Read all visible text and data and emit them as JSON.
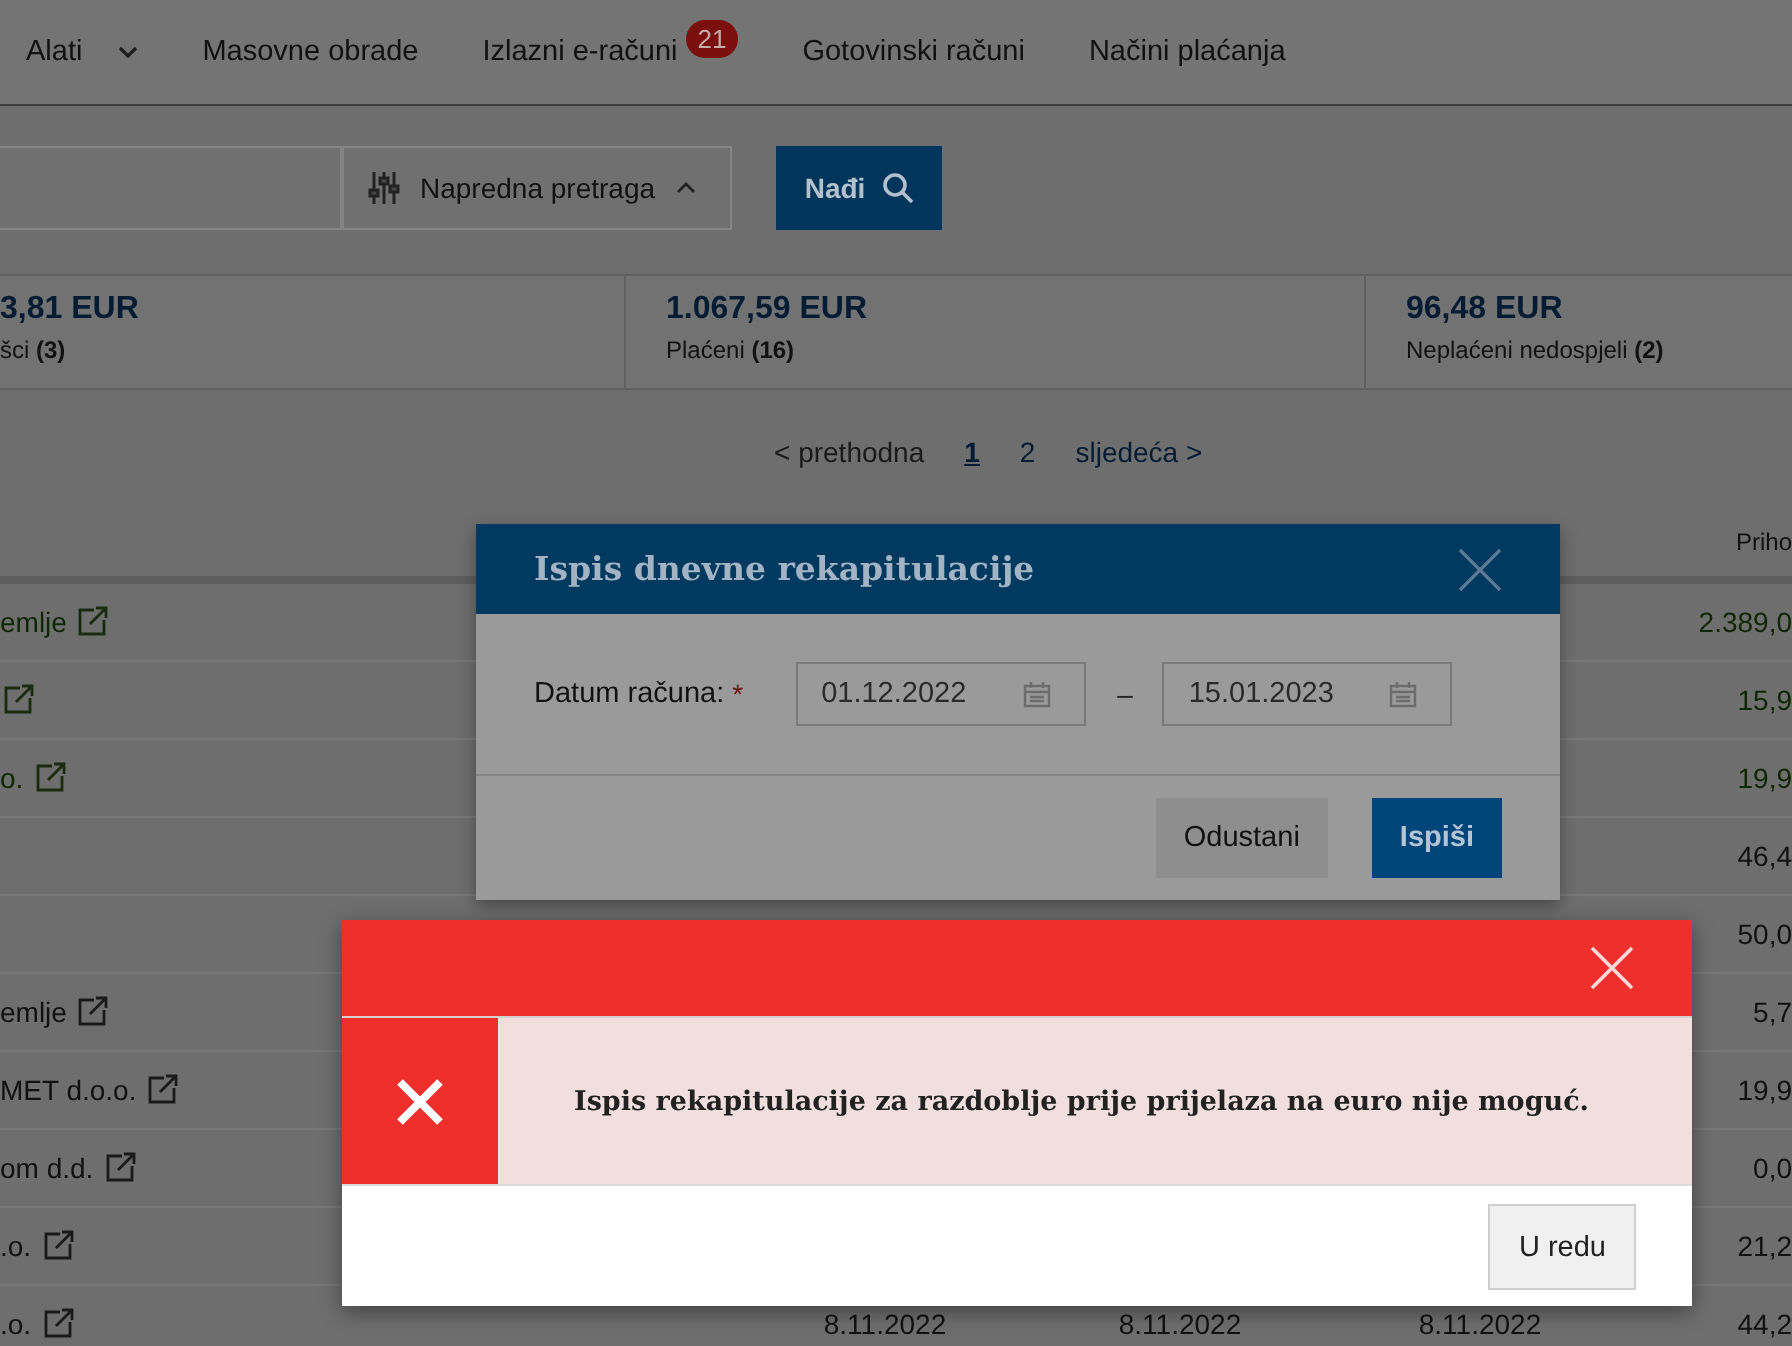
{
  "nav": {
    "items": [
      {
        "label": "Alati",
        "has_menu": true
      },
      {
        "label": "Masovne obrade",
        "has_menu": false
      },
      {
        "label": "Izlazni e-računi",
        "has_menu": false,
        "badge": "21"
      },
      {
        "label": "Gotovinski računi",
        "has_menu": false
      },
      {
        "label": "Načini plaćanja",
        "has_menu": false
      }
    ]
  },
  "search": {
    "advanced_label": "Napredna pretraga",
    "advanced_expanded": true,
    "find_label": "Nađi"
  },
  "summary": [
    {
      "amount": "3,81 EUR",
      "label": "šci **(3)**"
    },
    {
      "amount": "1.067,59 EUR",
      "label": "Plaćeni **(16)**"
    },
    {
      "amount": "96,48 EUR",
      "label": "Neplaćeni nedospjeli **(2)**"
    }
  ],
  "pagination": {
    "previous": "< prethodna",
    "pages": [
      {
        "label": "1",
        "selected": true
      },
      {
        "label": "2",
        "selected": false
      }
    ],
    "next": "sljedeća >"
  },
  "table": {
    "last_column_header": "Priho",
    "rows": [
      {
        "name": "emlje",
        "link": true,
        "paid": true,
        "amount": "2.389,0"
      },
      {
        "link": true,
        "paid": true,
        "amount": "15,9"
      },
      {
        "name": "o.",
        "link": true,
        "paid": true,
        "amount": "19,9"
      },
      {
        "link": false,
        "paid": false,
        "amount": "46,4"
      },
      {
        "link": false,
        "paid": false,
        "amount": "50,0"
      },
      {
        "name": "emlje",
        "link": true,
        "paid": false,
        "amount": "5,7"
      },
      {
        "name": "MET d.o.o.",
        "link": true,
        "paid": false,
        "amount": "19,9"
      },
      {
        "name": "om d.d.",
        "link": true,
        "paid": false,
        "amount": "0,0"
      },
      {
        "name": ".o.",
        "link": true,
        "paid": false,
        "amount": "21,2"
      },
      {
        "name": ".o.",
        "link": true,
        "paid": false,
        "dates": [
          "8.11.2022",
          "8.11.2022",
          "8.11.2022"
        ],
        "amount": "44,2"
      }
    ]
  },
  "dialog": {
    "title": "Ispis dnevne rekapitulacije",
    "field_label": "Datum računa:",
    "required_mark": "*",
    "date_from": "01.12.2022",
    "separator": "–",
    "date_to": "15.01.2023",
    "buttons": [
      {
        "label": "Odustani",
        "kind": "secondary"
      },
      {
        "label": "Ispiši",
        "kind": "primary"
      }
    ]
  },
  "error": {
    "message": "Ispis rekapitulacije za razdoblje prije prijelaza na euro nije moguć.",
    "button": "U redu"
  }
}
